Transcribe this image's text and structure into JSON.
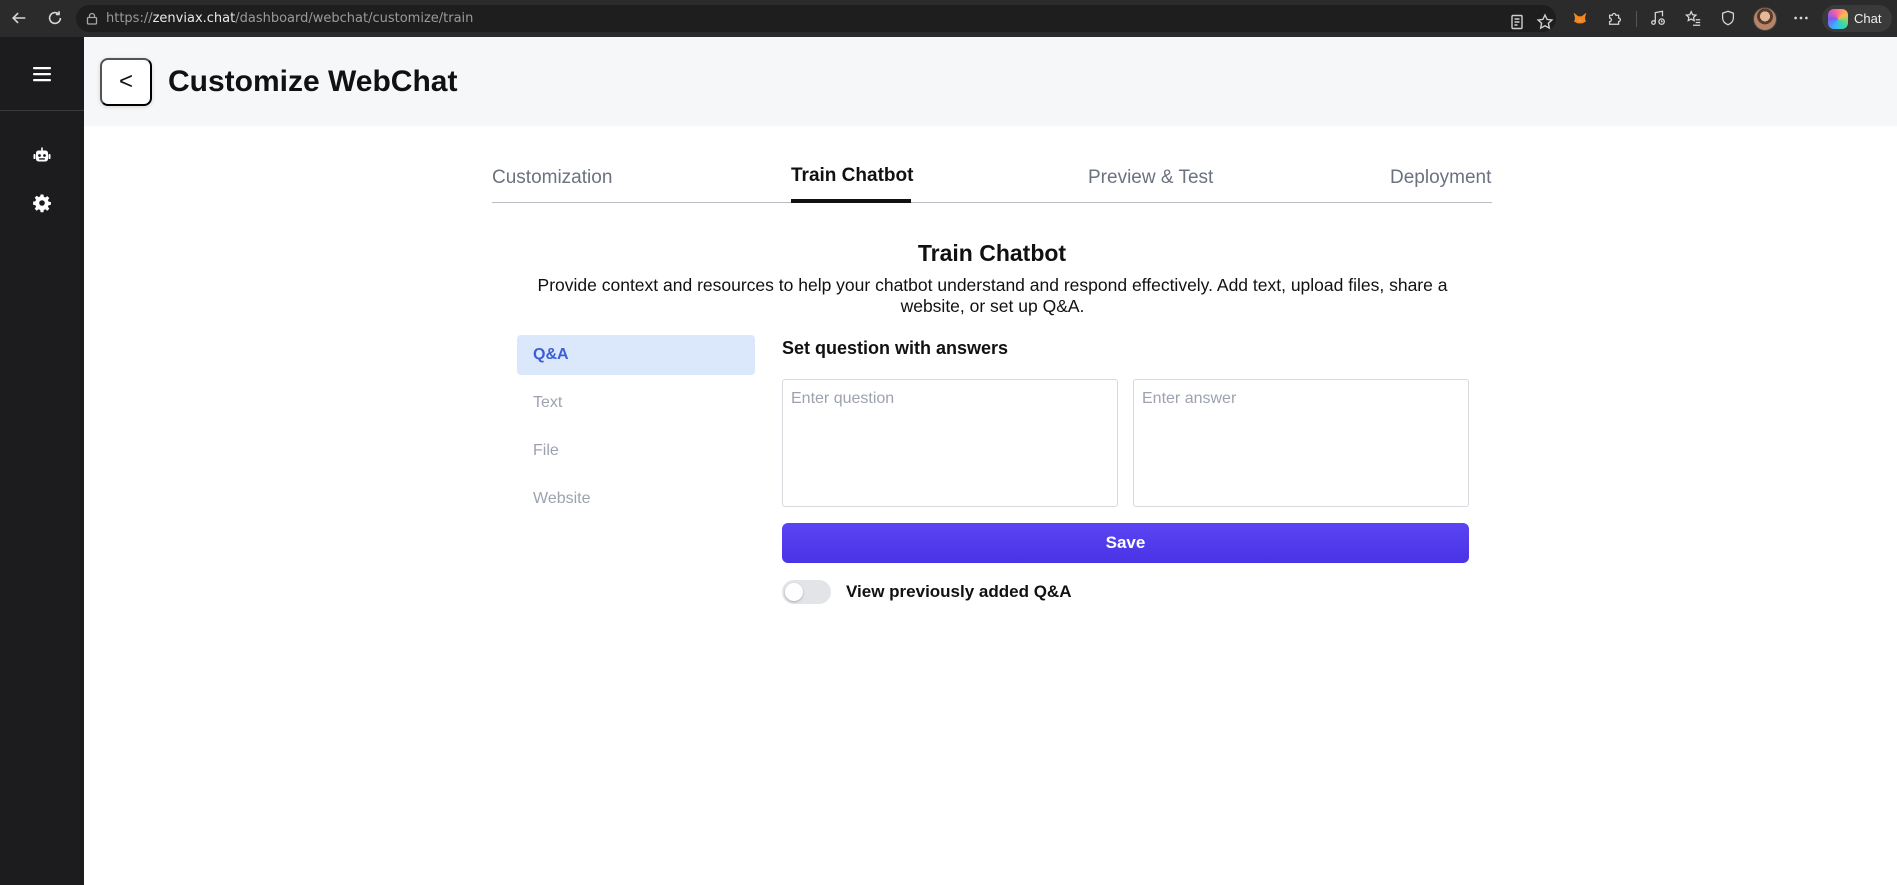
{
  "browser": {
    "url_prefix": "https://",
    "url_host": "zenviax.chat",
    "url_path": "/dashboard/webchat/customize/train",
    "chat_label": "Chat"
  },
  "header": {
    "back_label": "<",
    "title": "Customize WebChat"
  },
  "tabs": [
    {
      "label": "Customization"
    },
    {
      "label": "Train Chatbot"
    },
    {
      "label": "Preview & Test"
    },
    {
      "label": "Deployment"
    }
  ],
  "active_tab": "Train Chatbot",
  "section": {
    "title": "Train Chatbot",
    "description": "Provide context and resources to help your chatbot understand and respond effectively. Add text, upload files, share a website, or set up Q&A."
  },
  "train_menu": [
    {
      "label": "Q&A"
    },
    {
      "label": "Text"
    },
    {
      "label": "File"
    },
    {
      "label": "Website"
    }
  ],
  "active_menu": "Q&A",
  "qa": {
    "title": "Set question with answers",
    "question_placeholder": "Enter question",
    "answer_placeholder": "Enter answer",
    "save_label": "Save",
    "toggle_label": "View previously added Q&A",
    "toggle_on": false
  },
  "colors": {
    "accent": "#4a33e6",
    "active_menu_bg": "#dbe7fb",
    "active_menu_text": "#3b5fd4",
    "sidebar_bg": "#1c1c1e"
  }
}
